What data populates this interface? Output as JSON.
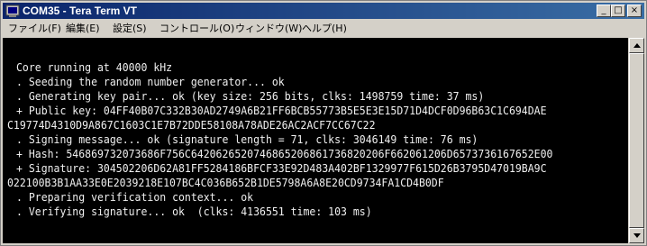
{
  "window": {
    "title": "COM35 - Tera Term VT",
    "controls": {
      "minimize": "_",
      "maximize": "□",
      "close": "×"
    }
  },
  "menu": {
    "items": [
      {
        "label": "ファイル(F)"
      },
      {
        "label": "編集(E)"
      },
      {
        "label": "設定(S)"
      },
      {
        "label": "コントロール(O)"
      },
      {
        "label": "ウィンドウ(W)"
      },
      {
        "label": "ヘルプ(H)"
      }
    ]
  },
  "terminal": {
    "lines": [
      "Core running at 40000 kHz",
      ". Seeding the random number generator... ok",
      ". Generating key pair... ok (key size: 256 bits, clks: 1498759 time: 37 ms)",
      "+ Public key: 04FF40B07C332B30AD2749A6B21FF6BCB55773B5E5E3E15D71D4DCF0D96B63C1C694DAE",
      "C19774D4310D9A867C1603C1E7B72DDE58108A78ADE26AC2ACF7CC67C22",
      ". Signing message... ok (signature length = 71, clks: 3046149 time: 76 ms)",
      "+ Hash: 546869732073686F756C6420626520746865206861736820206F662061206D6573736167652E00",
      "+ Signature: 304502206D62A81FF5284186BFCF33E92D483A402BF1329977F615D26B3795D47019BA9C",
      "022100B3B1AA33E0E2039218E107BC4C036B652B1DE5798A6A8E20CD9734FA1CD4B0DF",
      ". Preparing verification context... ok",
      ". Verifying signature... ok  (clks: 4136551 time: 103 ms)"
    ]
  },
  "colors": {
    "titlebar_start": "#0a246a",
    "titlebar_end": "#3a6ea5",
    "terminal_bg": "#000000",
    "terminal_fg": "#f0f0f0"
  }
}
